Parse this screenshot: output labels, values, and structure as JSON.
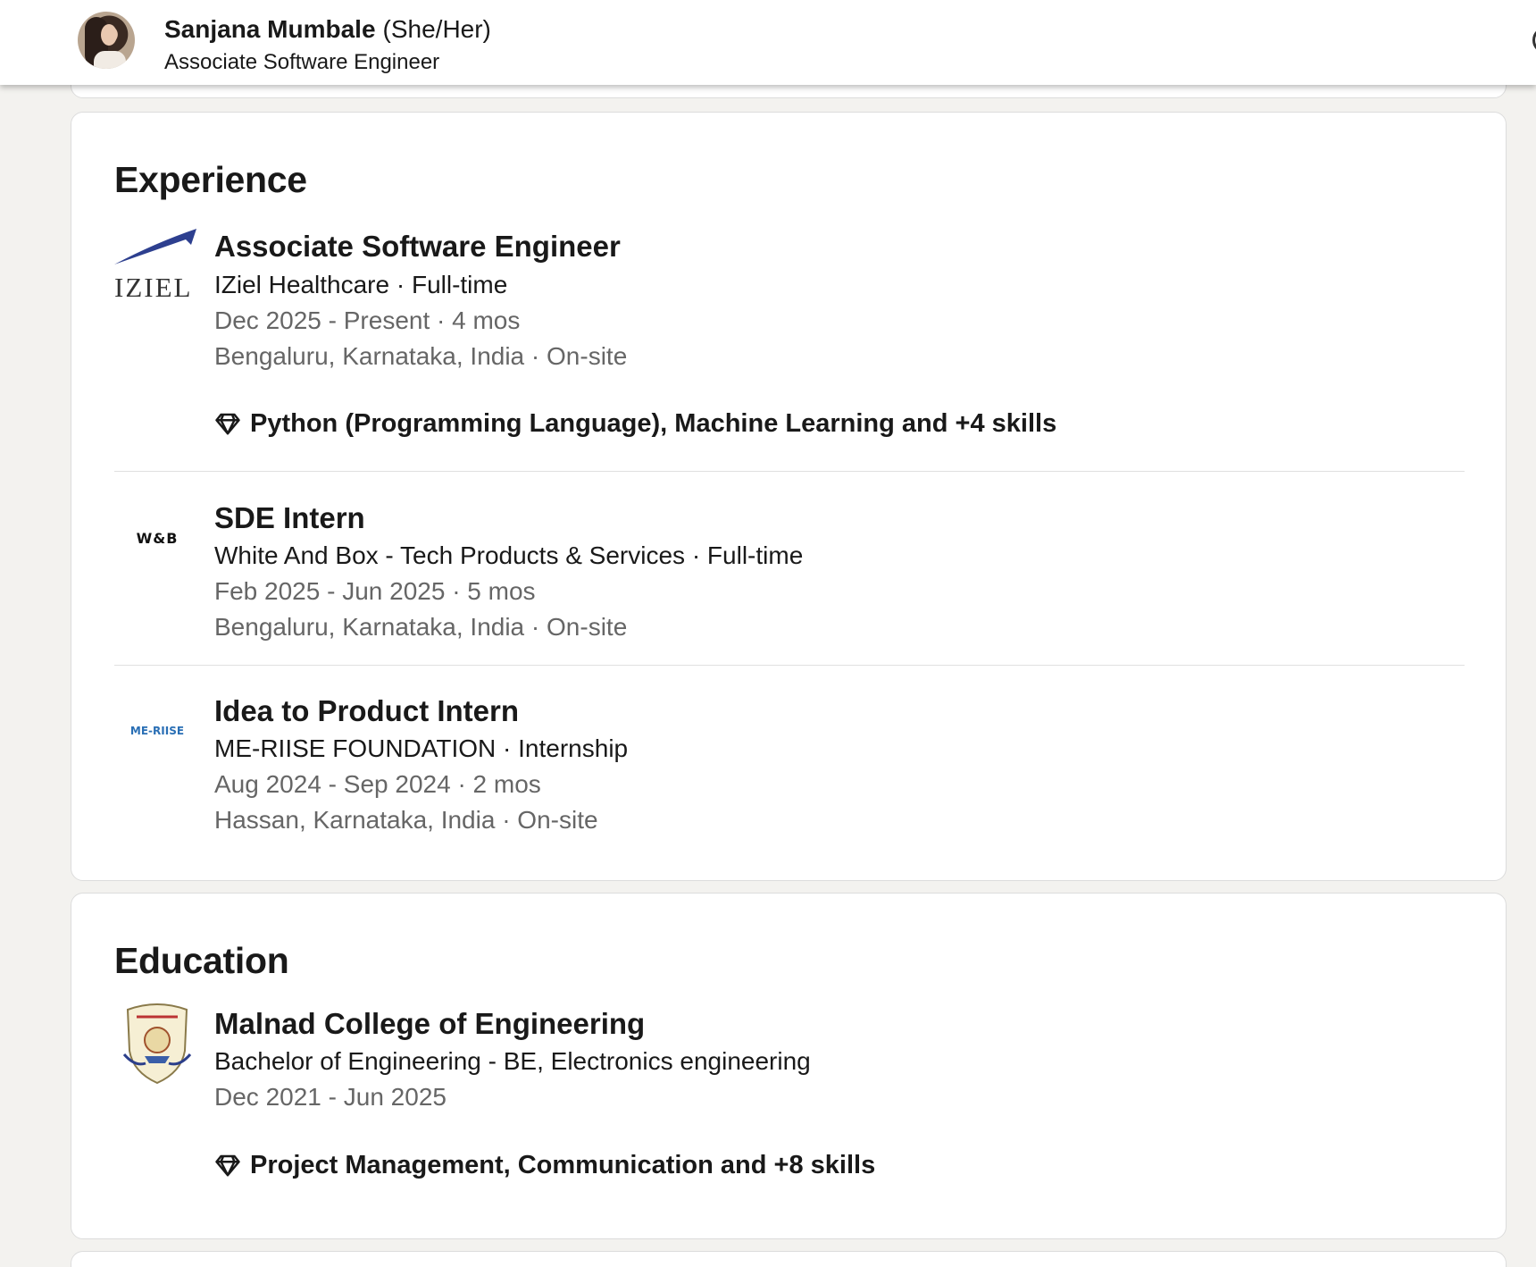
{
  "header": {
    "name": "Sanjana Mumbale",
    "pronouns": "(She/Her)",
    "headline": "Associate Software Engineer"
  },
  "experience": {
    "title": "Experience",
    "items": [
      {
        "logo_text": "IZIEL",
        "title": "Associate Software Engineer",
        "company_line": "IZiel Healthcare · Full-time",
        "dates": "Dec 2025 - Present · 4 mos",
        "location": "Bengaluru, Karnataka, India · On-site",
        "skills": "Python (Programming Language), Machine Learning and +4 skills"
      },
      {
        "logo_text": "W&B",
        "title": "SDE Intern",
        "company_line": "White And Box - Tech Products & Services · Full-time",
        "dates": "Feb 2025 - Jun 2025 · 5 mos",
        "location": "Bengaluru, Karnataka, India · On-site"
      },
      {
        "logo_text": "ME-RIISE",
        "title": " Idea to Product Intern",
        "company_line": "ME-RIISE FOUNDATION · Internship",
        "dates": "Aug 2024 - Sep 2024 · 2 mos",
        "location": "Hassan, Karnataka, India · On-site"
      }
    ]
  },
  "education": {
    "title": "Education",
    "items": [
      {
        "school": "Malnad College of Engineering",
        "degree": "Bachelor of Engineering - BE, Electronics engineering",
        "dates": "Dec 2021 - Jun 2025",
        "skills": "Project Management, Communication and +8 skills"
      }
    ]
  },
  "icons": {
    "skills": "diamond-icon",
    "accent_iziel": "#2d3f8f",
    "accent_meriise": "#2a6fb5"
  }
}
